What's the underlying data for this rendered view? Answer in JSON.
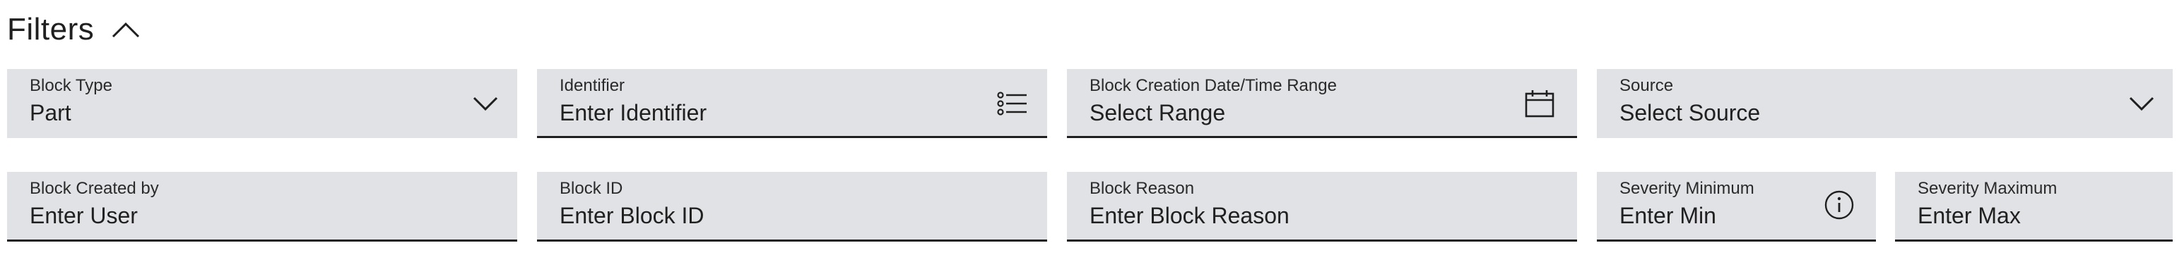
{
  "filters": {
    "title": "Filters",
    "row1": {
      "block_type": {
        "label": "Block Type",
        "value": "Part",
        "icon": "chevron-down-icon"
      },
      "identifier": {
        "label": "Identifier",
        "placeholder": "Enter Identifier",
        "icon": "list-icon"
      },
      "creation_range": {
        "label": "Block Creation Date/Time Range",
        "placeholder": "Select Range",
        "icon": "calendar-icon"
      },
      "source": {
        "label": "Source",
        "placeholder": "Select Source",
        "icon": "chevron-down-icon"
      }
    },
    "row2": {
      "created_by": {
        "label": "Block Created by",
        "placeholder": "Enter User"
      },
      "block_id": {
        "label": "Block ID",
        "placeholder": "Enter Block ID"
      },
      "block_reason": {
        "label": "Block Reason",
        "placeholder": "Enter Block Reason"
      },
      "severity_min": {
        "label": "Severity Minimum",
        "placeholder": "Enter Min",
        "icon": "info-icon"
      },
      "severity_max": {
        "label": "Severity Maximum",
        "placeholder": "Enter Max"
      }
    }
  }
}
